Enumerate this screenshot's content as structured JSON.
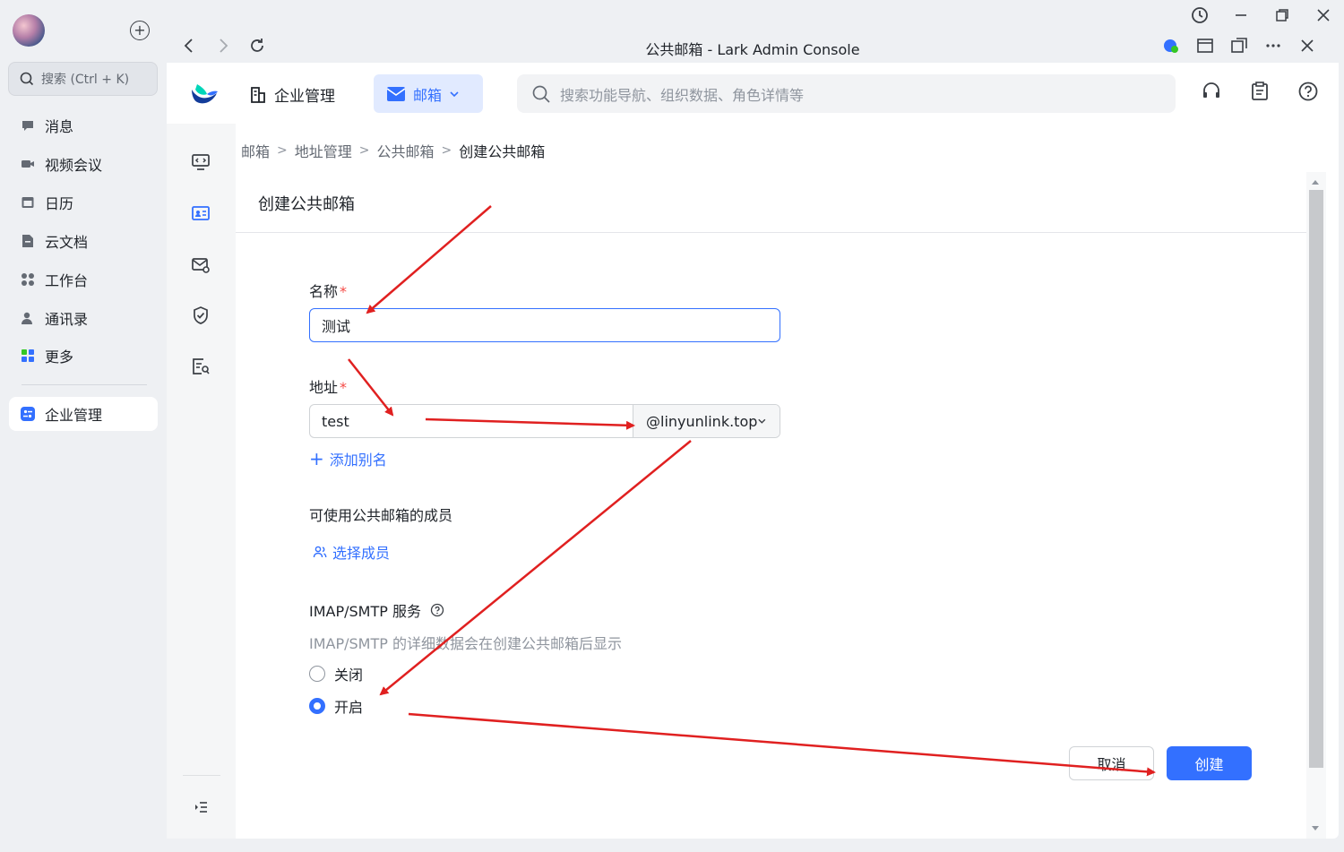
{
  "sidebar": {
    "search_placeholder": "搜索 (Ctrl + K)",
    "items": [
      {
        "label": "消息",
        "icon": "message-icon"
      },
      {
        "label": "视频会议",
        "icon": "video-meeting-icon"
      },
      {
        "label": "日历",
        "icon": "calendar-icon"
      },
      {
        "label": "云文档",
        "icon": "docs-icon"
      },
      {
        "label": "工作台",
        "icon": "workplace-icon"
      },
      {
        "label": "通讯录",
        "icon": "contacts-icon"
      },
      {
        "label": "更多",
        "icon": "more-apps-icon"
      }
    ],
    "active_item": {
      "label": "企业管理",
      "icon": "admin-icon"
    }
  },
  "window": {
    "title": "公共邮箱 - Lark Admin Console"
  },
  "header": {
    "admin_title": "企业管理",
    "product_switch": "邮箱",
    "search_placeholder": "搜索功能导航、组织数据、角色详情等"
  },
  "breadcrumb": [
    "邮箱",
    "地址管理",
    "公共邮箱",
    "创建公共邮箱"
  ],
  "form": {
    "title": "创建公共邮箱",
    "name_label": "名称",
    "name_value": "测试",
    "required_mark": "*",
    "address_label": "地址",
    "address_value": "test",
    "domain_value": "@linyunlink.top",
    "add_alias": "添加别名",
    "members_label": "可使用公共邮箱的成员",
    "select_members": "选择成员",
    "imap_label": "IMAP/SMTP 服务",
    "imap_hint": "IMAP/SMTP 的详细数据会在创建公共邮箱后显示",
    "radio_off": "关闭",
    "radio_on": "开启",
    "imap_enabled": true,
    "cancel": "取消",
    "create": "创建"
  },
  "colors": {
    "accent": "#3370ff",
    "annotation_arrow": "#e02020",
    "required": "#f54a45"
  }
}
